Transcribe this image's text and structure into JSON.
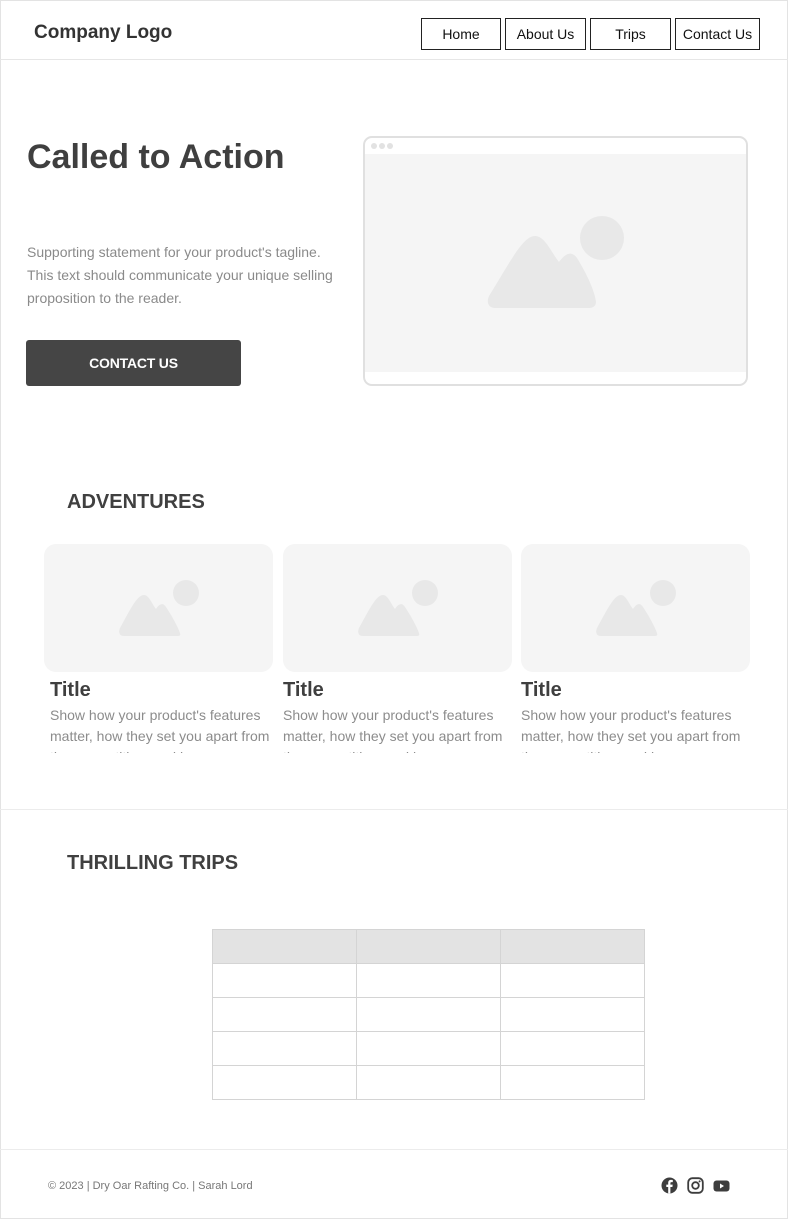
{
  "header": {
    "logo": "Company Logo",
    "nav": [
      "Home",
      "About Us",
      "Trips",
      "Contact Us"
    ]
  },
  "hero": {
    "title": "Called to Action",
    "text": "Supporting statement for your product's tagline. This text should communicate your unique selling proposition to the reader.",
    "cta": "CONTACT US"
  },
  "adventures": {
    "title": "ADVENTURES",
    "cards": [
      {
        "title": "Title",
        "text": "Show how your product's features matter, how they set you apart from the competition, and how"
      },
      {
        "title": "Title",
        "text": "Show how your product's features matter, how they set you apart from the competition, and how"
      },
      {
        "title": "Title",
        "text": "Show how your product's features matter, how they set you apart from the competition, and how"
      }
    ]
  },
  "trips": {
    "title": "THRILLING TRIPS",
    "columns": [
      "",
      "",
      ""
    ],
    "rows": [
      [
        "",
        "",
        ""
      ],
      [
        "",
        "",
        ""
      ],
      [
        "",
        "",
        ""
      ],
      [
        "",
        "",
        ""
      ]
    ]
  },
  "footer": {
    "text": "© 2023 | Dry Oar Rafting Co. | Sarah Lord",
    "icons": [
      "facebook-icon",
      "instagram-icon",
      "youtube-icon"
    ]
  },
  "colors": {
    "dark": "#454545",
    "placeholder": "#f5f5f5",
    "placeholder_shape": "#e8e8e8",
    "table_header": "#e3e3e3"
  }
}
